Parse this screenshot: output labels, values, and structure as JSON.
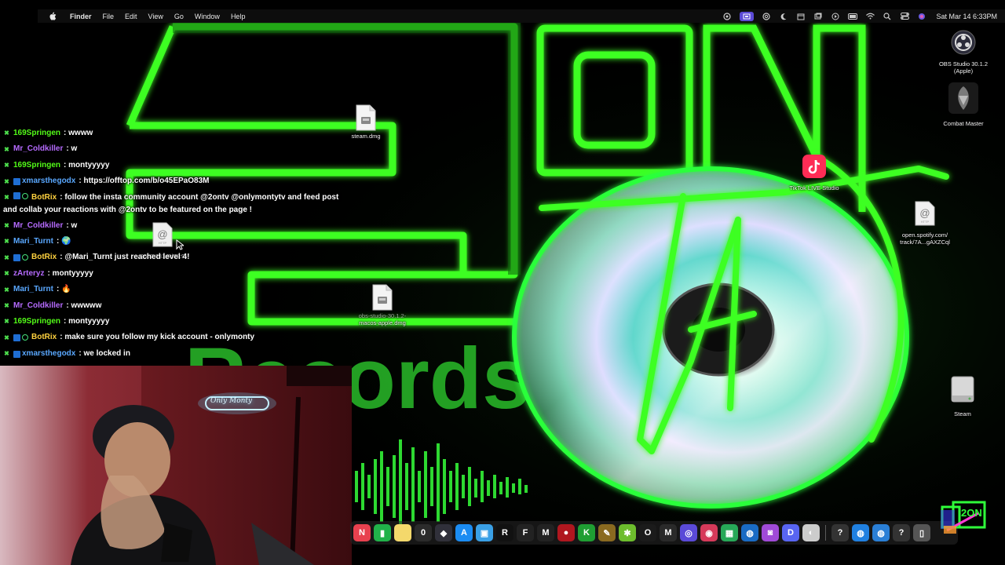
{
  "menubar": {
    "app_name": "Finder",
    "items": [
      "File",
      "Edit",
      "View",
      "Go",
      "Window",
      "Help"
    ],
    "clock": "Sat Mar 14  6:33PM",
    "status_icons": [
      "vpn-icon",
      "screen-record-icon",
      "camera-icon",
      "focus-moon-icon",
      "calendar-icon",
      "window-icon",
      "play-circle-icon",
      "battery-icon",
      "wifi-icon",
      "search-icon",
      "control-center-icon",
      "siri-icon"
    ]
  },
  "wallpaper": {
    "brand_text": "Records",
    "accent_color": "#39ff14"
  },
  "desktop_icons": [
    {
      "name": "steam-dmg",
      "label": "steam.dmg",
      "type": "dmg"
    },
    {
      "name": "obs-dmg",
      "label": "obs-studio-30.1.2-\nmacos-apple.dmg",
      "label_lines": [
        "obs-studio-30.1.2-",
        "macos-apple.dmg"
      ],
      "type": "dmg"
    },
    {
      "name": "ip-location",
      "label_lines": [
        "2600:381:6d32:9",
        "..."
      ],
      "type": "http"
    },
    {
      "name": "obs-studio-app",
      "label_lines": [
        "OBS Studio 30.1.2",
        "(Apple)"
      ],
      "type": "app"
    },
    {
      "name": "combat-master-app",
      "label_lines": [
        "Combat Master"
      ],
      "type": "app"
    },
    {
      "name": "tiktok-live-studio-app",
      "label_lines": [
        "TikTok LIVE Studio"
      ],
      "type": "app"
    },
    {
      "name": "spotify-location",
      "label_lines": [
        "open.spotify.com/",
        "track/7A...gAXZCql"
      ],
      "type": "http"
    },
    {
      "name": "steam-volume",
      "label_lines": [
        "Steam"
      ],
      "type": "volume"
    }
  ],
  "chat": {
    "messages": [
      {
        "user": "169Springen",
        "color": "green",
        "text": "wwww",
        "badges": [
          "kick"
        ]
      },
      {
        "user": "Mr_Coldkiller",
        "color": "purple",
        "text": "w",
        "badges": [
          "kick"
        ]
      },
      {
        "user": "169Springen",
        "color": "green",
        "text": "montyyyyy",
        "badges": [
          "kick"
        ]
      },
      {
        "user": "xmarsthegodx",
        "color": "blue",
        "text": "https://offtop.com/b/o45EPaO83M",
        "badges": [
          "kick",
          "blue"
        ]
      },
      {
        "user": "BotRix",
        "color": "gold",
        "text": "follow the insta community account @2ontv @onlymontytv and feed post and collab your reactions with @2ontv to be featured on the page !",
        "badges": [
          "kick",
          "blue",
          "green"
        ]
      },
      {
        "user": "Mr_Coldkiller",
        "color": "purple",
        "text": "w",
        "badges": [
          "kick"
        ]
      },
      {
        "user": "Mari_Turnt",
        "color": "blue",
        "text": "🌍",
        "badges": [
          "kick"
        ]
      },
      {
        "user": "BotRix",
        "color": "gold",
        "text": "@Mari_Turnt just reached level 4!",
        "badges": [
          "kick",
          "blue",
          "green"
        ]
      },
      {
        "user": "zArteryz",
        "color": "purple",
        "text": "montyyyyy",
        "badges": [
          "kick"
        ]
      },
      {
        "user": "Mari_Turnt",
        "color": "blue",
        "text": "🔥",
        "badges": [
          "kick"
        ]
      },
      {
        "user": "Mr_Coldkiller",
        "color": "purple",
        "text": "wwwww",
        "badges": [
          "kick"
        ]
      },
      {
        "user": "169Springen",
        "color": "green",
        "text": "montyyyyy",
        "badges": [
          "kick"
        ]
      },
      {
        "user": "BotRix",
        "color": "gold",
        "text": "make sure you follow my kick account - onlymonty",
        "badges": [
          "kick",
          "blue",
          "green"
        ]
      },
      {
        "user": "xmarsthegodx",
        "color": "blue",
        "text": "we locked in",
        "badges": [
          "kick",
          "blue"
        ]
      }
    ]
  },
  "webcam": {
    "neon_sign_text": "Only Monty"
  },
  "dock": {
    "apps": [
      {
        "name": "news-icon",
        "glyph": "N",
        "color": "#e8414f"
      },
      {
        "name": "numbers-icon",
        "glyph": "▮",
        "color": "#21b24a"
      },
      {
        "name": "notes-icon",
        "glyph": "",
        "color": "#f4d86b"
      },
      {
        "name": "counter-app-icon",
        "glyph": "0",
        "color": "#2b2b2b"
      },
      {
        "name": "script-icon",
        "glyph": "◆",
        "color": "#30303a"
      },
      {
        "name": "app-store-icon",
        "glyph": "A",
        "color": "#1b8cf2"
      },
      {
        "name": "preview-icon",
        "glyph": "▣",
        "color": "#3aa0e6"
      },
      {
        "name": "rockstar-icon",
        "glyph": "R",
        "color": "#111111"
      },
      {
        "name": "f-app-icon",
        "glyph": "F",
        "color": "#222222"
      },
      {
        "name": "m-app-icon",
        "glyph": "M",
        "color": "#222222"
      },
      {
        "name": "record-icon",
        "glyph": "●",
        "color": "#b0171f"
      },
      {
        "name": "kick-icon",
        "glyph": "K",
        "color": "#1f9e33"
      },
      {
        "name": "tools-icon",
        "glyph": "✎",
        "color": "#8a6a20"
      },
      {
        "name": "snake-icon",
        "glyph": "✱",
        "color": "#6dbd2d"
      },
      {
        "name": "obs-icon",
        "glyph": "O",
        "color": "#1b1b1b"
      },
      {
        "name": "m-app-2-icon",
        "glyph": "M",
        "color": "#2a2a2a"
      },
      {
        "name": "controller-icon",
        "glyph": "◎",
        "color": "#5a4ad8"
      },
      {
        "name": "photo-booth-icon",
        "glyph": "◉",
        "color": "#d63a5a"
      },
      {
        "name": "grid-app-icon",
        "glyph": "▦",
        "color": "#27a858"
      },
      {
        "name": "finder-search-icon",
        "glyph": "◍",
        "color": "#1a6bc4"
      },
      {
        "name": "screen-capture-icon",
        "glyph": "◙",
        "color": "#a04ad8"
      },
      {
        "name": "discord-icon",
        "glyph": "D",
        "color": "#5865f2"
      },
      {
        "name": "chrome-icon",
        "glyph": "◐",
        "color": "#cccccc"
      },
      {
        "name": "help-icon",
        "glyph": "?",
        "color": "#333333"
      },
      {
        "name": "globe-icon",
        "glyph": "◍",
        "color": "#2080e0"
      },
      {
        "name": "globe-2-icon",
        "glyph": "◍",
        "color": "#2a7fd6"
      },
      {
        "name": "help-2-icon",
        "glyph": "?",
        "color": "#333333"
      },
      {
        "name": "trash-icon",
        "glyph": "▯",
        "color": "#555555"
      }
    ]
  },
  "overlay_brand": {
    "logo_text": "2ON"
  }
}
